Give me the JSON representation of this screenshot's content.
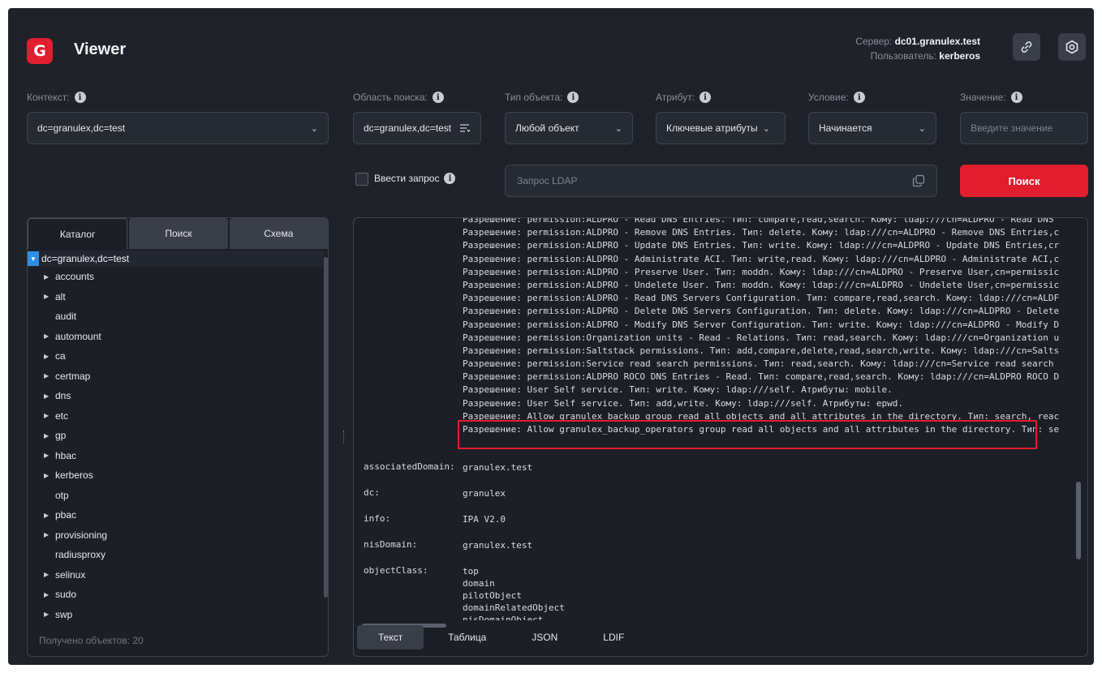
{
  "header": {
    "logo_text": "G",
    "title": "Viewer",
    "server_label": "Сервер:",
    "server_value": "dc01.granulex.test",
    "user_label": "Пользователь:",
    "user_value": "kerberos",
    "link_icon": "link-icon",
    "settings_icon": "settings-icon"
  },
  "form": {
    "context_label": "Контекст:",
    "context_value": "dc=granulex,dc=test",
    "scope_label": "Область поиска:",
    "scope_value": "dc=granulex,dc=test",
    "object_type_label": "Тип объекта:",
    "object_type_value": "Любой объект",
    "attribute_label": "Атрибут:",
    "attribute_value": "Ключевые атрибуты",
    "condition_label": "Условие:",
    "condition_value": "Начинается",
    "value_label": "Значение:",
    "value_placeholder": "Введите значение",
    "query_checkbox_label": "Ввести запрос",
    "ldap_placeholder": "Запрос LDAP",
    "search_button": "Поиск"
  },
  "left_panel": {
    "tabs": [
      "Каталог",
      "Поиск",
      "Схема"
    ],
    "active_tab": "Каталог",
    "root": "dc=granulex,dc=test",
    "items": [
      {
        "label": "accounts",
        "expandable": true
      },
      {
        "label": "alt",
        "expandable": true
      },
      {
        "label": "audit",
        "expandable": false
      },
      {
        "label": "automount",
        "expandable": true
      },
      {
        "label": "ca",
        "expandable": true
      },
      {
        "label": "certmap",
        "expandable": true
      },
      {
        "label": "dns",
        "expandable": true
      },
      {
        "label": "etc",
        "expandable": true
      },
      {
        "label": "gp",
        "expandable": true
      },
      {
        "label": "hbac",
        "expandable": true
      },
      {
        "label": "kerberos",
        "expandable": true
      },
      {
        "label": "otp",
        "expandable": false
      },
      {
        "label": "pbac",
        "expandable": true
      },
      {
        "label": "provisioning",
        "expandable": true
      },
      {
        "label": "radiusproxy",
        "expandable": false
      },
      {
        "label": "selinux",
        "expandable": true
      },
      {
        "label": "sudo",
        "expandable": true
      },
      {
        "label": "swp",
        "expandable": true
      }
    ],
    "count_text": "Получено объектов: 20"
  },
  "output": {
    "permission_lines": [
      "Разрешение: permission:ALDPRO - Read DNS Entries. Тип: compare,read,search. Кому: ldap:///cn=ALDPRO - Read DNS",
      "Разрешение: permission:ALDPRO - Remove DNS Entries. Тип: delete. Кому: ldap:///cn=ALDPRO - Remove DNS Entries,c",
      "Разрешение: permission:ALDPRO - Update DNS Entries. Тип: write. Кому: ldap:///cn=ALDPRO - Update DNS Entries,cr",
      "Разрешение: permission:ALDPRO - Administrate ACI. Тип: write,read. Кому: ldap:///cn=ALDPRO - Administrate ACI,c",
      "Разрешение: permission:ALDPRO - Preserve User. Тип: moddn. Кому: ldap:///cn=ALDPRO - Preserve User,cn=permissic",
      "Разрешение: permission:ALDPRO - Undelete User. Тип: moddn. Кому: ldap:///cn=ALDPRO - Undelete User,cn=permissic",
      "Разрешение: permission:ALDPRO - Read DNS Servers Configuration. Тип: compare,read,search. Кому: ldap:///cn=ALDF",
      "Разрешение: permission:ALDPRO - Delete DNS Servers Configuration. Тип: delete. Кому: ldap:///cn=ALDPRO - Delete",
      "Разрешение: permission:ALDPRO - Modify DNS Server Configuration. Тип: write. Кому: ldap:///cn=ALDPRO - Modify D",
      "Разрешение: permission:Organization units - Read - Relations. Тип: read,search. Кому: ldap:///cn=Organization u",
      "Разрешение: permission:Saltstack permissions. Тип: add,compare,delete,read,search,write. Кому: ldap:///cn=Salts",
      "Разрешение: permission:Service read search permissions. Тип: read,search. Кому: ldap:///cn=Service read search",
      "Разрешение: permission:ALDPRO ROCO DNS Entries - Read. Тип: compare,read,search. Кому: ldap:///cn=ALDPRO ROCO D",
      "Разрешение: User Self service. Тип: write. Кому: ldap:///self. Атрибуты: mobile.",
      "Разрешение: User Self service. Тип: add,write. Кому: ldap:///self. Атрибуты: epwd.",
      "Разрешение: Allow granulex_backup group read all objects and all attributes in the directory. Тип: search, reac",
      "Разрешение: Allow granulex_backup_operators group read all objects and all attributes in the directory. Тип: se"
    ],
    "attributes": [
      {
        "key": "associatedDomain:",
        "values": [
          "granulex.test"
        ]
      },
      {
        "key": "dc:",
        "values": [
          "granulex"
        ]
      },
      {
        "key": "info:",
        "values": [
          "IPA V2.0"
        ]
      },
      {
        "key": "nisDomain:",
        "values": [
          "granulex.test"
        ]
      },
      {
        "key": "objectClass:",
        "values": [
          "top",
          "domain",
          "pilotObject",
          "domainRelatedObject",
          "nisDomainObject"
        ]
      }
    ]
  },
  "format_tabs": [
    "Текст",
    "Таблица",
    "JSON",
    "LDIF"
  ],
  "active_format": "Текст",
  "colors": {
    "accent": "#e11d2e",
    "background": "#1f2229",
    "tree_root": "#2f8ee6"
  }
}
